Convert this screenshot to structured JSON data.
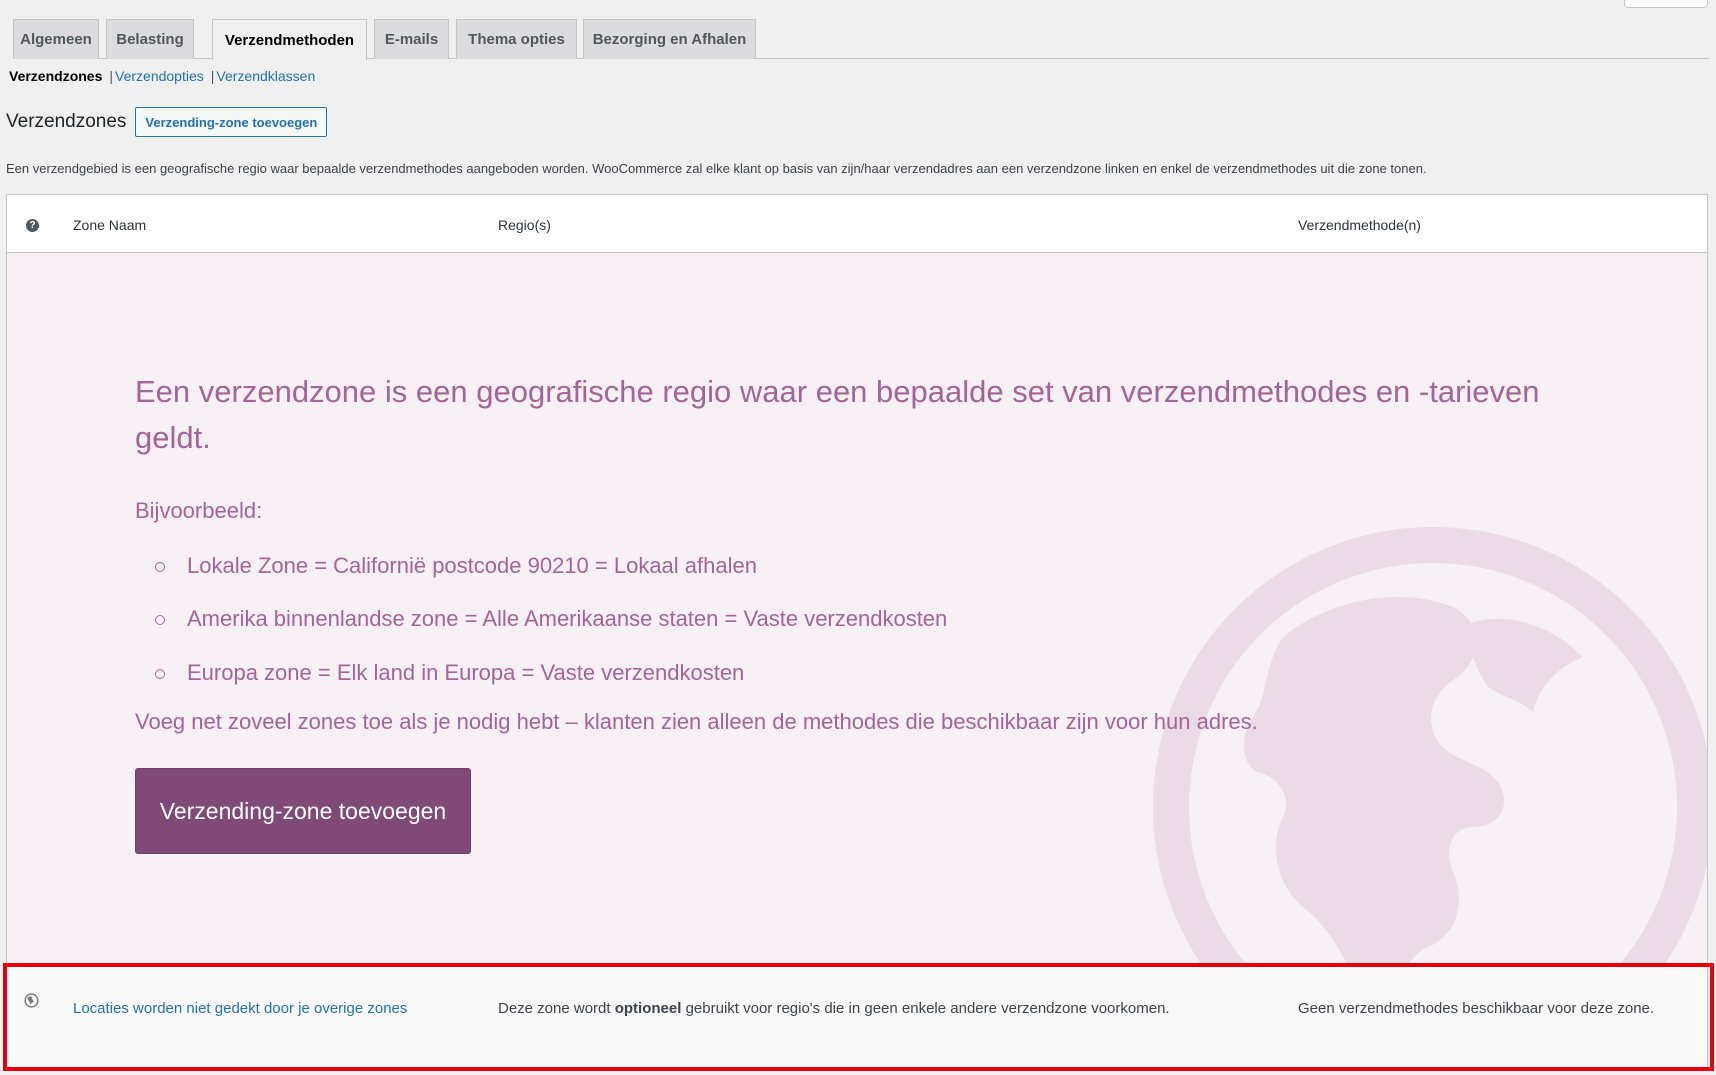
{
  "tabs": [
    {
      "label": "Algemeen",
      "active": false
    },
    {
      "label": "Belasting",
      "active": false
    },
    {
      "label": "Verzendmethoden",
      "active": true
    },
    {
      "label": "E-mails",
      "active": false
    },
    {
      "label": "Thema opties",
      "active": false
    },
    {
      "label": "Bezorging en Afhalen",
      "active": false
    }
  ],
  "subnav": {
    "current": "Verzendzones",
    "sep": "|",
    "options": "Verzendopties",
    "classes": "Verzendklassen"
  },
  "heading": {
    "title": "Verzendzones",
    "add_button": "Verzending-zone toevoegen"
  },
  "intro": "Een verzendgebied is een geografische regio waar bepaalde verzendmethodes aangeboden worden. WooCommerce zal elke klant op basis van zijn/haar verzendadres aan een verzendzone linken en enkel de verzendmethodes uit die zone tonen.",
  "table": {
    "help_icon": "?",
    "col_name": "Zone Naam",
    "col_region": "Regio(s)",
    "col_methods": "Verzendmethode(n)"
  },
  "blank_state": {
    "title": "Een verzendzone is een geografische regio waar een bepaalde set van verzendmethodes en -tarieven geldt.",
    "example_label": "Bijvoorbeeld:",
    "examples": [
      "Lokale Zone = Californië postcode 90210 = Lokaal afhalen",
      "Amerika binnenlandse zone = Alle Amerikaanse staten = Vaste verzendkosten",
      "Europa zone = Elk land in Europa = Vaste verzendkosten"
    ],
    "footer": "Voeg net zoveel zones toe als je nodig hebt – klanten zien alleen de methodes die beschikbaar zijn voor hun adres.",
    "button": "Verzending-zone toevoegen",
    "watermark_icon": "globe-icon"
  },
  "rest_of_world": {
    "icon": "globe-icon",
    "link": "Locaties worden niet gedekt door je overige zones",
    "desc_before": "Deze zone wordt ",
    "desc_bold": "optioneel",
    "desc_after": " gebruikt voor regio's die in geen enkele andere verzendzone voorkomen.",
    "methods": "Geen verzendmethodes beschikbaar voor deze zone."
  },
  "colors": {
    "accent_purple": "#7f4a77",
    "blank_text": "#a46497",
    "link_blue": "#2271b1",
    "highlight_red": "#e3000f"
  }
}
